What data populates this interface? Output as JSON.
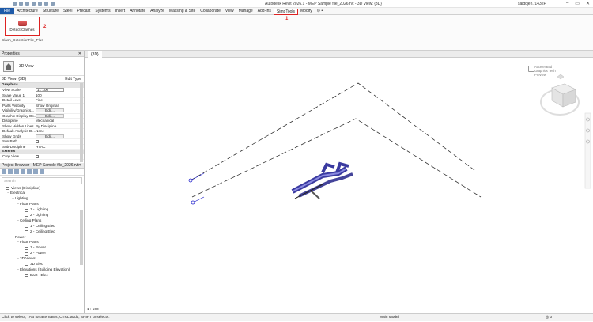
{
  "titlebar": {
    "title": "Autodesk Revit 2026.1 - MEP Sample file_2026.rvt - 3D View: {3D}",
    "user": "saidcjen.r1432P",
    "minimize": "–",
    "maximize": "▭",
    "close": "✕"
  },
  "tabs": [
    "File",
    "Architecture",
    "Structure",
    "Steel",
    "Precast",
    "Systems",
    "Insert",
    "Annotate",
    "Analyze",
    "Massing & Site",
    "Collaborate",
    "View",
    "Manage",
    "Add-Ins",
    "SimpTools",
    "Modify",
    "⊙ •"
  ],
  "ribbon": {
    "button_label": "Detect Clashes",
    "panel_label": "Clash_DetectionFile_Plus",
    "marker_button": "2",
    "marker_tab": "1"
  },
  "properties": {
    "header": "Properties",
    "close": "✕",
    "type_name": "3D View",
    "view_selector": "3D View: {3D}",
    "edit_type": "Edit Type",
    "section_graphics": "Graphics",
    "rows": [
      {
        "k": "View Scale",
        "v": "1 : 100",
        "kind": "box"
      },
      {
        "k": "Scale Value 1:",
        "v": "100",
        "kind": "text"
      },
      {
        "k": "Detail Level",
        "v": "Fine",
        "kind": "text"
      },
      {
        "k": "Parts Visibility",
        "v": "Show Original",
        "kind": "text"
      },
      {
        "k": "Visibility/Graphics...",
        "v": "Edit...",
        "kind": "btn"
      },
      {
        "k": "Graphic Display Op...",
        "v": "Edit...",
        "kind": "btn"
      },
      {
        "k": "Discipline",
        "v": "Mechanical",
        "kind": "text"
      },
      {
        "k": "Show Hidden Lines",
        "v": "By Discipline",
        "kind": "text"
      },
      {
        "k": "Default Analysis Di...",
        "v": "None",
        "kind": "text"
      },
      {
        "k": "Show Grids",
        "v": "Edit...",
        "kind": "btn"
      },
      {
        "k": "Sun Path",
        "v": "",
        "kind": "chk"
      },
      {
        "k": "Sub-Discipline",
        "v": "HVAC",
        "kind": "text"
      }
    ],
    "section_extents": "Extents",
    "row_crop": "Crop View"
  },
  "browser": {
    "header": "Project Browser - MEP Sample file_2026.rvt",
    "close": "✕",
    "search_placeholder": "Search",
    "tree": [
      {
        "label": "Views (Discipline)",
        "indent": 0,
        "toggle": "–",
        "icon": true
      },
      {
        "label": "Electrical",
        "indent": 1,
        "toggle": "–",
        "icon": false
      },
      {
        "label": "Lighting",
        "indent": 2,
        "toggle": "–",
        "icon": false
      },
      {
        "label": "Floor Plans",
        "indent": 3,
        "toggle": "–",
        "icon": false
      },
      {
        "label": "1 - Lighting",
        "indent": 4,
        "toggle": "",
        "icon": true
      },
      {
        "label": "2 - Lighting",
        "indent": 4,
        "toggle": "",
        "icon": true
      },
      {
        "label": "Ceiling Plans",
        "indent": 3,
        "toggle": "–",
        "icon": false
      },
      {
        "label": "1 - Ceiling Elec",
        "indent": 4,
        "toggle": "",
        "icon": true
      },
      {
        "label": "2 - Ceiling Elec",
        "indent": 4,
        "toggle": "",
        "icon": true
      },
      {
        "label": "Power",
        "indent": 2,
        "toggle": "–",
        "icon": false
      },
      {
        "label": "Floor Plans",
        "indent": 3,
        "toggle": "–",
        "icon": false
      },
      {
        "label": "1 - Power",
        "indent": 4,
        "toggle": "",
        "icon": true
      },
      {
        "label": "2 - Power",
        "indent": 4,
        "toggle": "",
        "icon": true
      },
      {
        "label": "3D Views",
        "indent": 3,
        "toggle": "–",
        "icon": false
      },
      {
        "label": "3D Elec",
        "indent": 4,
        "toggle": "",
        "icon": true
      },
      {
        "label": "Elevations (Building Elevation)",
        "indent": 3,
        "toggle": "–",
        "icon": false
      },
      {
        "label": "East - Elec",
        "indent": 4,
        "toggle": "",
        "icon": true
      }
    ]
  },
  "canvas": {
    "tab_label": "{3D}",
    "scale": "1 : 100",
    "accel_label": "Accelerated Graphics Tech Preview"
  },
  "status": {
    "hint": "Click to select, TAB for alternates, CTRL adds, SHIFT unselects.",
    "model": "Main Model",
    "filter": "◎ 0"
  }
}
